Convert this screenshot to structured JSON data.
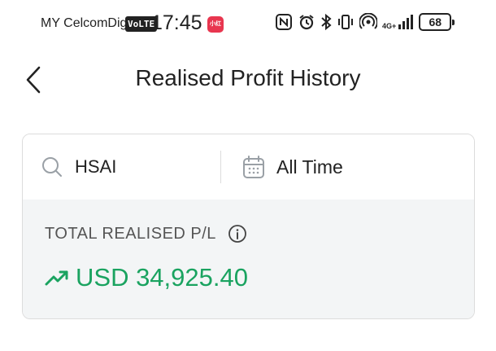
{
  "status_bar": {
    "carrier": "MY CelcomDigi",
    "volte": "VoLTE",
    "time": "17:45",
    "app_badge": "小红书",
    "network": "4G+",
    "battery": "68"
  },
  "header": {
    "title": "Realised Profit History",
    "back_icon": "chevron-left-icon"
  },
  "filters": {
    "search_value": "HSAI",
    "search_icon": "search-icon",
    "date_range": "All Time",
    "date_icon": "calendar-icon"
  },
  "summary": {
    "label": "TOTAL REALISED P/L",
    "info_icon": "info-icon",
    "trend_icon": "trending-up-icon",
    "value": "USD 34,925.40",
    "value_color": "#1aa360"
  }
}
